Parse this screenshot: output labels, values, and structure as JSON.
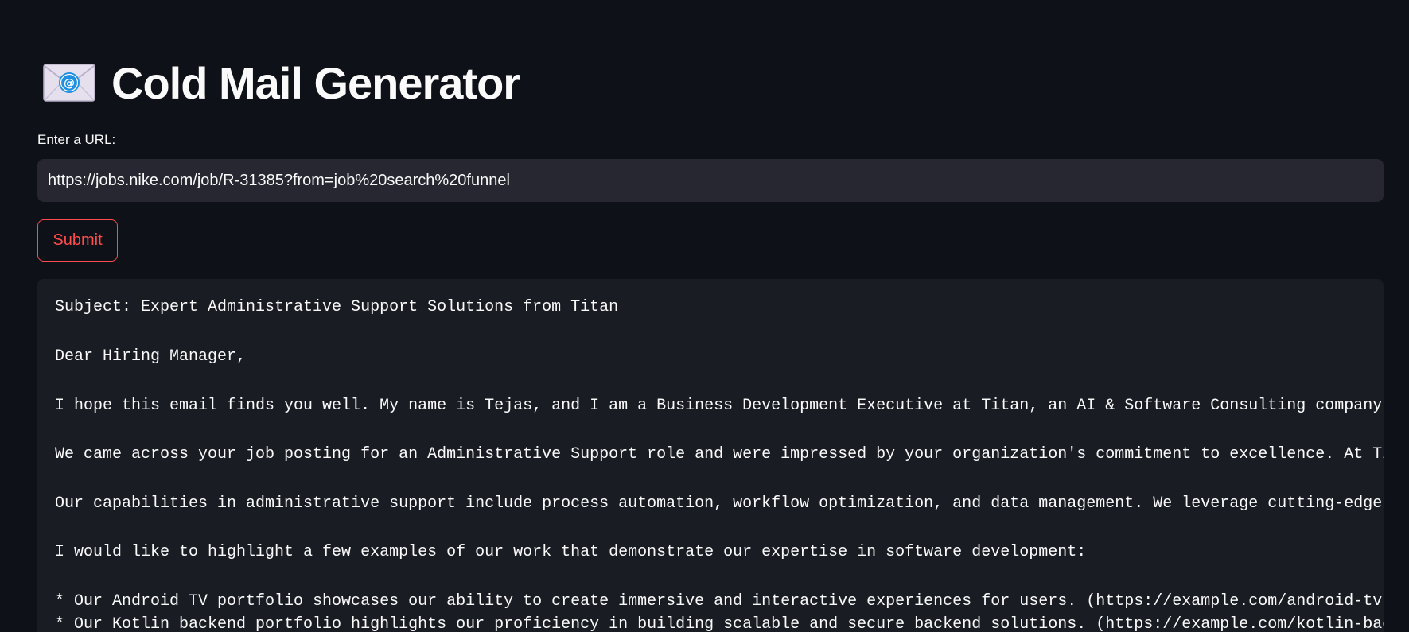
{
  "header": {
    "title": "Cold Mail Generator",
    "icon": "envelope-with-at-sign-icon"
  },
  "url_field": {
    "label": "Enter a URL:",
    "value": "https://jobs.nike.com/job/R-31385?from=job%20search%20funnel"
  },
  "submit": {
    "label": "Submit"
  },
  "colors": {
    "background": "#0e1117",
    "input_background": "#262730",
    "code_background": "#1a1c24",
    "accent": "#ff4b4b",
    "text": "#fafafa"
  },
  "email_output": {
    "lines": [
      "Subject: Expert Administrative Support Solutions from Titan",
      "Dear Hiring Manager,",
      "I hope this email finds you well. My name is Tejas, and I am a Business Development Executive at Titan, an AI & Software Consulting company dedic",
      "We came across your job posting for an Administrative Support role and were impressed by your organization's commitment to excellence. At Titan,",
      "Our capabilities in administrative support include process automation, workflow optimization, and data management. We leverage cutting-edge techn",
      "I would like to highlight a few examples of our work that demonstrate our expertise in software development:",
      "* Our Android TV portfolio showcases our ability to create immersive and interactive experiences for users. (https://example.com/android-tv-portf",
      "* Our Kotlin backend portfolio highlights our proficiency in building scalable and secure backend solutions. (https://example.com/kotlin-backend-"
    ]
  }
}
